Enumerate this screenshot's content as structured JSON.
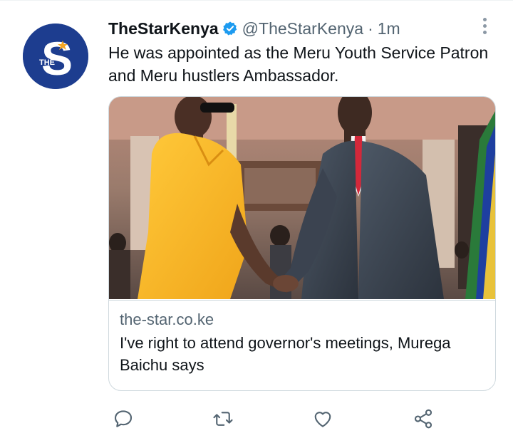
{
  "tweet": {
    "display_name": "TheStarKenya",
    "handle": "@TheStarKenya",
    "separator": "·",
    "time": "1m",
    "text": "He was appointed as the Meru Youth Service Patron and Meru hustlers Ambassador.",
    "verified": true,
    "avatar": {
      "letter": "S",
      "tag": "THE",
      "background": "#1d3d8f",
      "star_color": "#f5a623"
    }
  },
  "card": {
    "domain": "the-star.co.ke",
    "title": "I've right to attend governor's meetings, Murega Baichu says",
    "image_description_icon": "photo-handshake"
  },
  "actions": {
    "reply": "reply-icon",
    "retweet": "retweet-icon",
    "like": "heart-icon",
    "share": "share-icon"
  },
  "colors": {
    "text_primary": "#0f1419",
    "text_secondary": "#536471",
    "verified_blue": "#1d9bf0",
    "border": "#cfd9de"
  }
}
